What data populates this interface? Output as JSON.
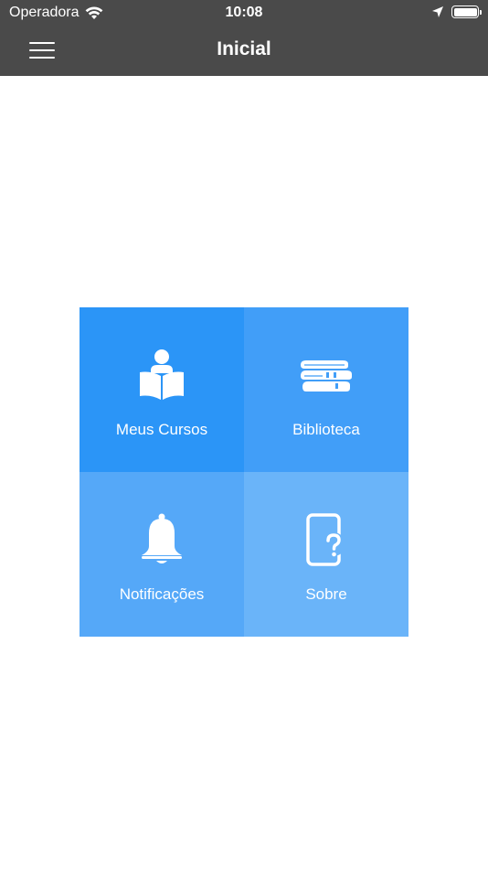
{
  "status_bar": {
    "carrier": "Operadora",
    "time": "10:08",
    "icons": [
      "wifi-icon",
      "location-icon",
      "battery-icon"
    ]
  },
  "nav": {
    "title": "Inicial",
    "menu_icon": "hamburger-menu-icon"
  },
  "tiles": [
    {
      "label": "Meus Cursos",
      "icon": "reading-person-icon",
      "color": "#2b95f7"
    },
    {
      "label": "Biblioteca",
      "icon": "books-stack-icon",
      "color": "#419ef8"
    },
    {
      "label": "Notificações",
      "icon": "bell-icon",
      "color": "#55a8f8"
    },
    {
      "label": "Sobre",
      "icon": "phone-question-icon",
      "color": "#6ab4f9"
    }
  ],
  "colors": {
    "header_bg": "#4a4a4a",
    "background": "#ffffff"
  }
}
